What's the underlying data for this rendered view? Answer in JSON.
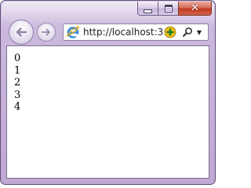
{
  "window": {
    "caption_buttons": {
      "minimize_icon": "minimize-icon",
      "maximize_icon": "maximize-icon",
      "close_icon": "close-icon",
      "close_glyph": "✕"
    },
    "frame_color": "#cbb8dd",
    "close_color": "#c03a22"
  },
  "toolbar": {
    "back_icon": "back-arrow-icon",
    "forward_icon": "forward-arrow-icon",
    "address": {
      "url": "http://localhost:3",
      "page_icon": "ie-icon",
      "compat_icon": "compatibility-view-icon",
      "search_icon": "search-icon",
      "dropdown_icon": "chevron-down-icon",
      "dropdown_glyph": "▼"
    }
  },
  "content": {
    "items": [
      "0",
      "1",
      "2",
      "3",
      "4"
    ]
  }
}
